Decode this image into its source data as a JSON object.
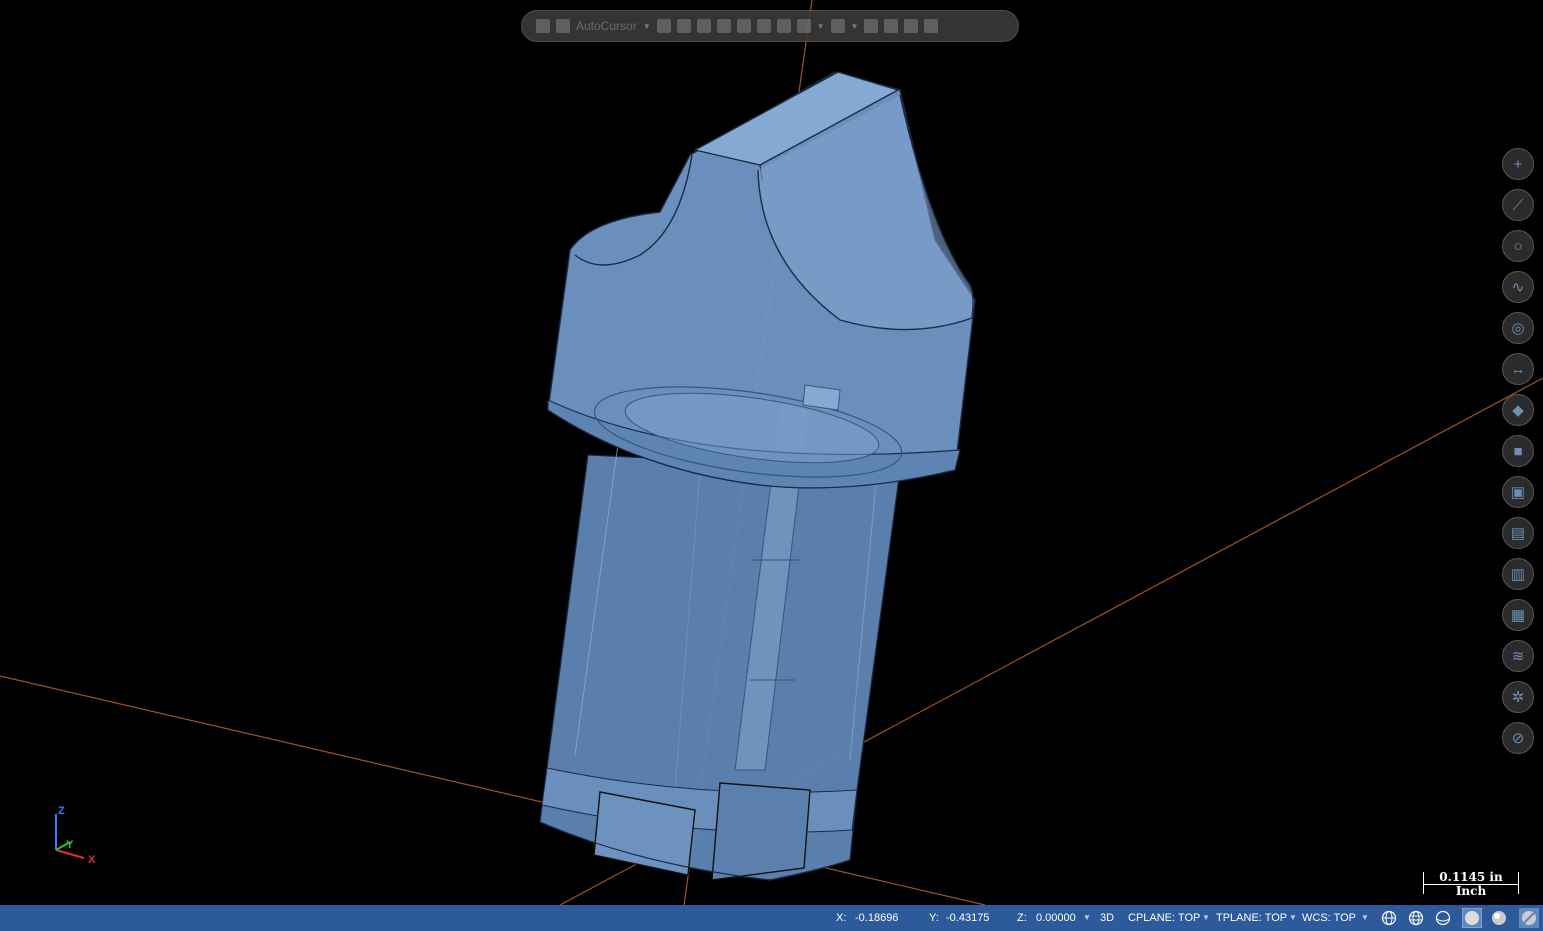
{
  "toolbar": {
    "autocursor_label": "AutoCursor"
  },
  "right_toolbar": {
    "items": [
      {
        "name": "add-icon",
        "glyph": "+"
      },
      {
        "name": "line-icon",
        "glyph": "⟋"
      },
      {
        "name": "circle-icon",
        "glyph": "○"
      },
      {
        "name": "spline-icon",
        "glyph": "∿"
      },
      {
        "name": "surface-icon",
        "glyph": "◎"
      },
      {
        "name": "dimension-icon",
        "glyph": "↔"
      },
      {
        "name": "transform-icon",
        "glyph": "◆"
      },
      {
        "name": "solid-icon",
        "glyph": "■"
      },
      {
        "name": "color-icon",
        "glyph": "▣"
      },
      {
        "name": "levels-icon",
        "glyph": "▤"
      },
      {
        "name": "attributes-icon",
        "glyph": "▥"
      },
      {
        "name": "grid-icon",
        "glyph": "▦"
      },
      {
        "name": "layers-icon",
        "glyph": "≋"
      },
      {
        "name": "settings-icon",
        "glyph": "✲"
      },
      {
        "name": "clear-icon",
        "glyph": "⊘"
      }
    ]
  },
  "triad": {
    "z": "Z",
    "y": "Y",
    "x": "X"
  },
  "scale": {
    "value": "0.1145 in",
    "unit": "Inch"
  },
  "status": {
    "x_label": "X:",
    "x_value": "-0.18696",
    "y_label": "Y:",
    "y_value": "-0.43175",
    "z_label": "Z:",
    "z_value": "0.00000",
    "mode": "3D",
    "cplane": "CPLANE: TOP",
    "tplane": "TPLANE: TOP",
    "wcs": "WCS: TOP"
  },
  "colors": {
    "background": "#000000",
    "part_fill": "#6f94c2",
    "axis_line": "#a0521e",
    "status_bar": "#2d5a9b"
  }
}
